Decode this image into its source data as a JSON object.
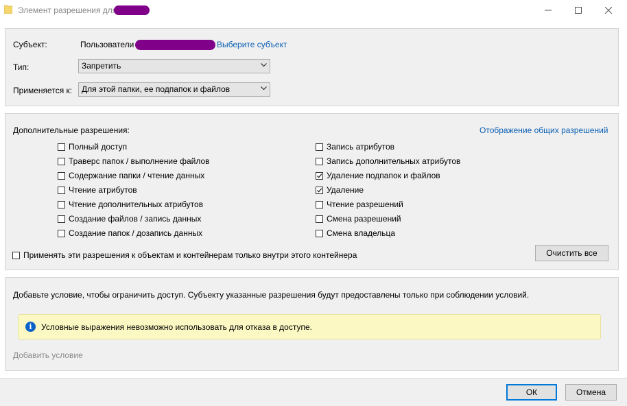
{
  "window": {
    "title": "Элемент разрешения для",
    "minimize_icon": "minimize-icon",
    "maximize_icon": "maximize-icon",
    "close_icon": "close-icon"
  },
  "principal": {
    "label": "Субъект:",
    "value": "Пользователи",
    "select_link": "Выберите субъект"
  },
  "type": {
    "label": "Тип:",
    "value": "Запретить"
  },
  "applies_to": {
    "label": "Применяется к:",
    "value": "Для этой папки, ее подпапок и файлов"
  },
  "permissions": {
    "header": "Дополнительные разрешения:",
    "show_basic_link": "Отображение общих разрешений",
    "left": [
      {
        "label": "Полный доступ",
        "checked": false
      },
      {
        "label": "Траверс папок / выполнение файлов",
        "checked": false
      },
      {
        "label": "Содержание папки / чтение данных",
        "checked": false
      },
      {
        "label": "Чтение атрибутов",
        "checked": false
      },
      {
        "label": "Чтение дополнительных атрибутов",
        "checked": false
      },
      {
        "label": "Создание файлов / запись данных",
        "checked": false
      },
      {
        "label": "Создание папок / дозапись данных",
        "checked": false
      }
    ],
    "right": [
      {
        "label": "Запись атрибутов",
        "checked": false
      },
      {
        "label": "Запись дополнительных атрибутов",
        "checked": false
      },
      {
        "label": "Удаление подпапок и файлов",
        "checked": true
      },
      {
        "label": "Удаление",
        "checked": true
      },
      {
        "label": "Чтение разрешений",
        "checked": false
      },
      {
        "label": "Смена разрешений",
        "checked": false
      },
      {
        "label": "Смена владельца",
        "checked": false
      }
    ],
    "apply_inside_label": "Применять эти разрешения к объектам и контейнерам только внутри этого контейнера",
    "clear_all_button": "Очистить все"
  },
  "condition": {
    "description": "Добавьте условие, чтобы ограничить доступ. Субъекту указанные разрешения будут предоставлены только при соблюдении условий.",
    "info_text": "Условные выражения невозможно использовать для отказа в доступе.",
    "add_link": "Добавить условие"
  },
  "footer": {
    "ok": "ОК",
    "cancel": "Отмена"
  },
  "colors": {
    "link": "#0a5fb4",
    "accent": "#0078d7",
    "redaction": "#80008a",
    "info_background": "#fcf8c3"
  }
}
